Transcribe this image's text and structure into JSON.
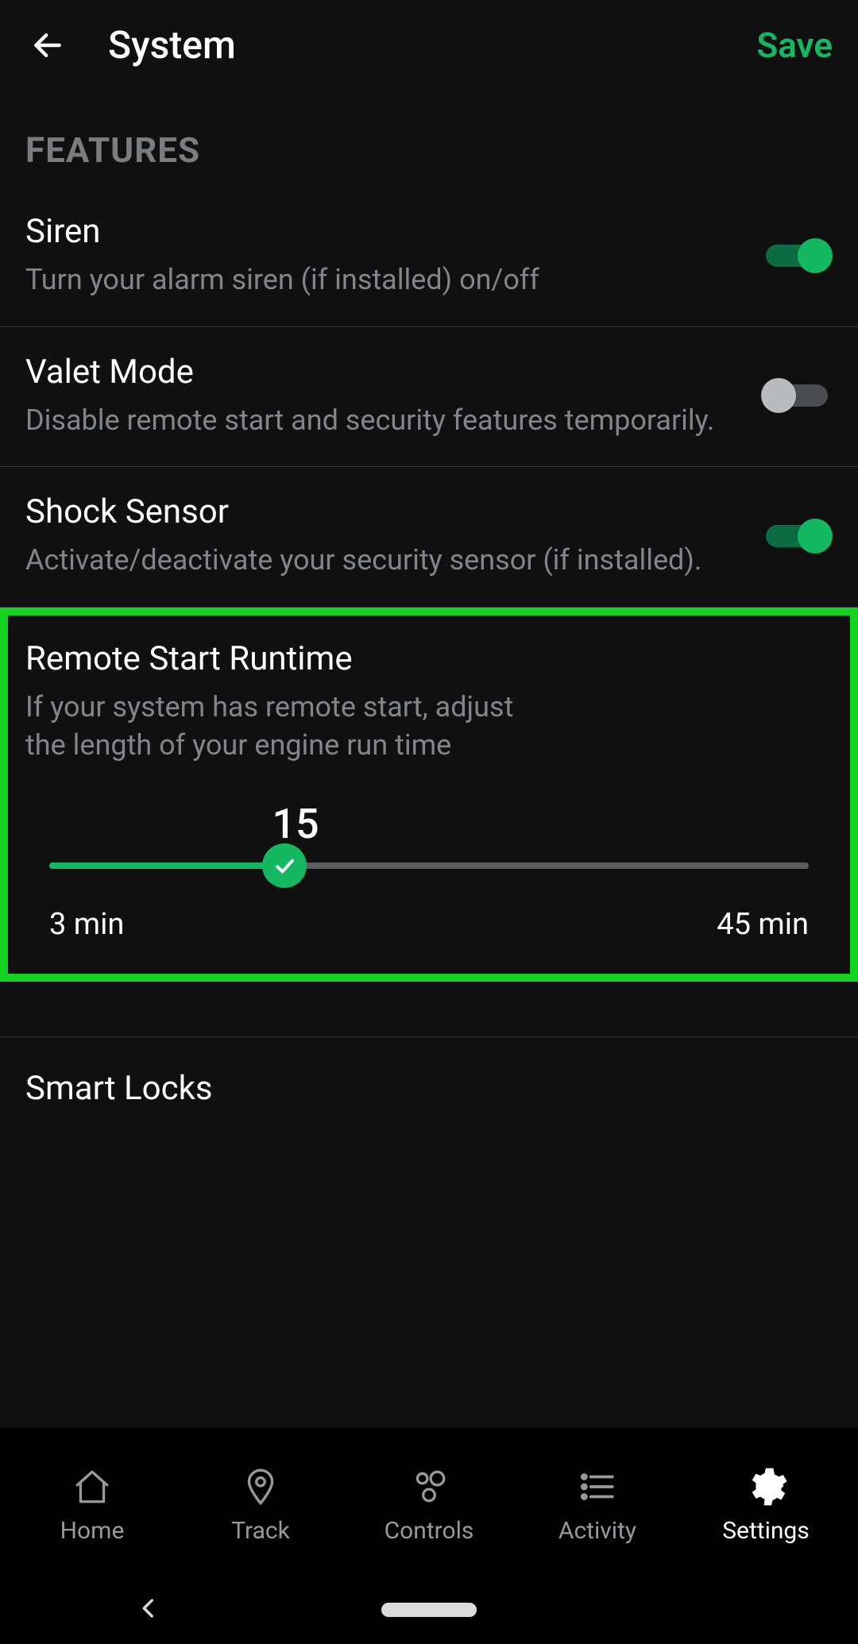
{
  "header": {
    "title": "System",
    "save_label": "Save"
  },
  "section_header": "FEATURES",
  "items": {
    "siren": {
      "title": "Siren",
      "desc": "Turn your alarm siren (if installed) on/off",
      "on": true
    },
    "valet": {
      "title": "Valet Mode",
      "desc": "Disable remote start and security features temporarily.",
      "on": false
    },
    "shock": {
      "title": "Shock Sensor",
      "desc": "Activate/deactivate your security sensor (if installed).",
      "on": true
    },
    "runtime": {
      "title": "Remote Start Runtime",
      "desc": "If your system has remote start, adjust the length of your engine run time",
      "value": "15",
      "min_label": "3 min",
      "max_label": "45 min"
    },
    "smartlocks": {
      "title": "Smart Locks"
    }
  },
  "tabs": {
    "home": "Home",
    "track": "Track",
    "controls": "Controls",
    "activity": "Activity",
    "settings": "Settings"
  }
}
